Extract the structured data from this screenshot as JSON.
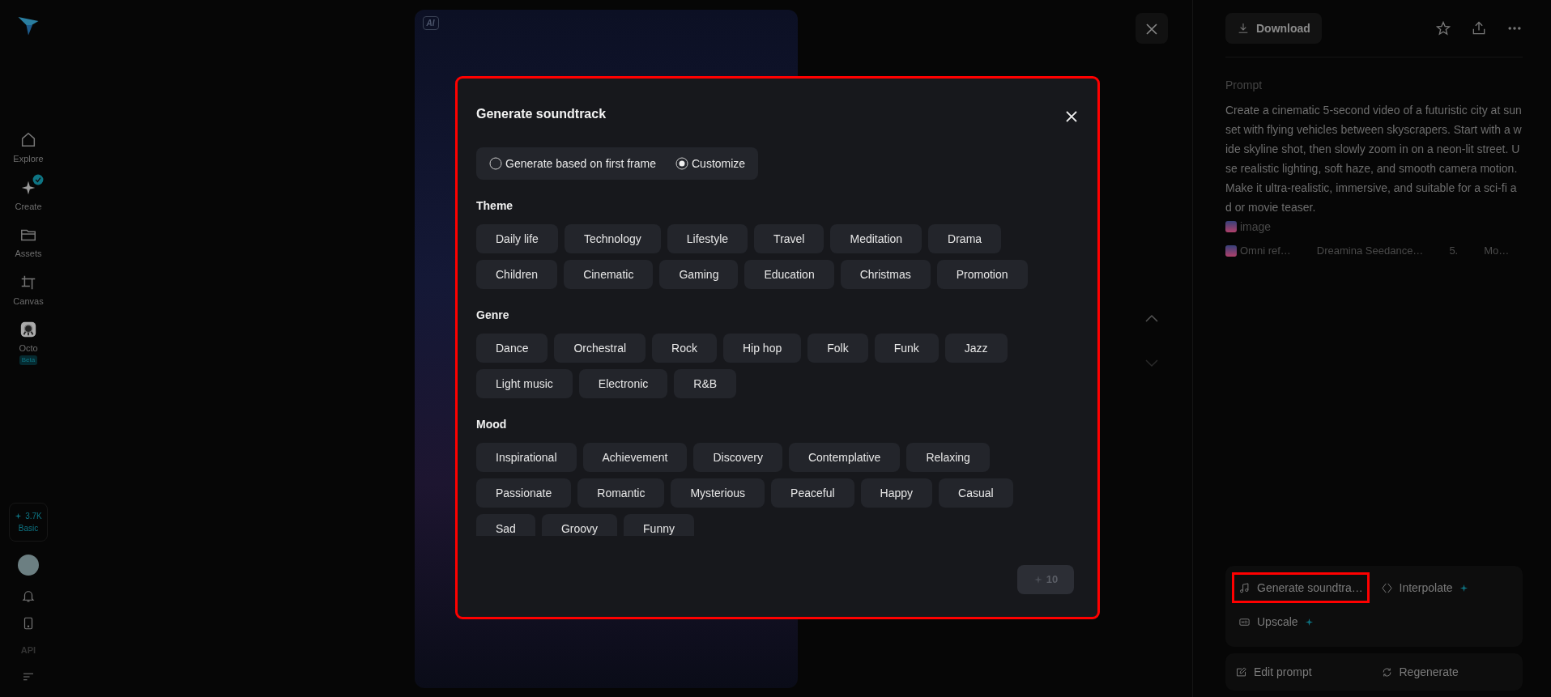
{
  "sidebar": {
    "items": [
      {
        "kind": "explore",
        "label": "Explore",
        "verified": false
      },
      {
        "kind": "create",
        "label": "Create",
        "verified": true
      },
      {
        "kind": "assets",
        "label": "Assets",
        "verified": false
      },
      {
        "kind": "canvas",
        "label": "Canvas",
        "verified": false
      },
      {
        "kind": "octo",
        "label": "Octo",
        "verified": false,
        "badge": "Beta"
      }
    ],
    "credits": {
      "amount": "3.7K",
      "plan": "Basic"
    },
    "api": "API"
  },
  "video": {
    "ai_badge": "AI"
  },
  "panel": {
    "download": "Download",
    "prompt_label": "Prompt",
    "prompt": "Create a cinematic 5-second video of a futuristic city at sunset with flying vehicles between skyscrapers. Start with a wide skyline shot, then slowly zoom in on a neon-lit street. Use realistic lighting, soft haze, and smooth camera motion. Make it ultra-realistic, immersive, and suitable for a sci-fi ad or movie teaser.",
    "prompt_ref": "image",
    "meta": [
      "Omni ref…",
      "Dreamina Seedance…",
      "5.",
      "Mo…"
    ],
    "actions": [
      {
        "kind": "soundtrack",
        "label": "Generate soundtra…",
        "plus": false,
        "highlighted": true
      },
      {
        "kind": "interpolate",
        "label": "Interpolate",
        "plus": true,
        "highlighted": false
      },
      {
        "kind": "upscale",
        "label": "Upscale",
        "plus": true,
        "highlighted": false
      }
    ],
    "edit_actions": [
      {
        "kind": "edit",
        "label": "Edit prompt"
      },
      {
        "kind": "regenerate",
        "label": "Regenerate"
      }
    ]
  },
  "modal": {
    "title": "Generate soundtrack",
    "highlighted": true,
    "modes": [
      {
        "label": "Generate based on first frame",
        "selected": false
      },
      {
        "label": "Customize",
        "selected": true
      }
    ],
    "sections": [
      {
        "title": "Theme",
        "tags": [
          "Daily life",
          "Technology",
          "Lifestyle",
          "Travel",
          "Meditation",
          "Drama",
          "Children",
          "Cinematic",
          "Gaming",
          "Education",
          "Christmas",
          "Promotion"
        ]
      },
      {
        "title": "Genre",
        "tags": [
          "Dance",
          "Orchestral",
          "Rock",
          "Hip hop",
          "Folk",
          "Funk",
          "Jazz",
          "Light music",
          "Electronic",
          "R&B"
        ]
      },
      {
        "title": "Mood",
        "tags": [
          "Inspirational",
          "Achievement",
          "Discovery",
          "Contemplative",
          "Relaxing",
          "Passionate",
          "Romantic",
          "Mysterious",
          "Peaceful",
          "Happy",
          "Casual",
          "Sad",
          "Groovy",
          "Funny"
        ]
      }
    ],
    "submit": {
      "credits": "10",
      "disabled": true
    }
  }
}
